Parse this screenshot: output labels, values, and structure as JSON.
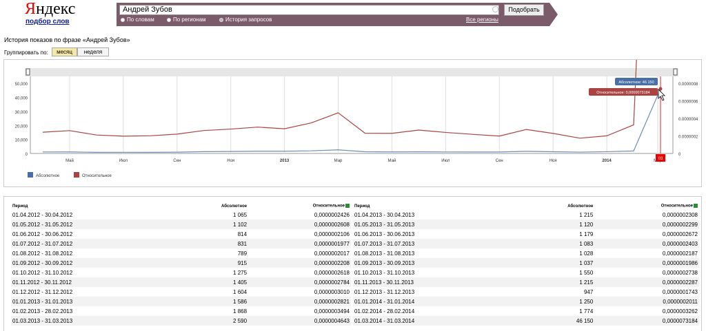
{
  "logo": {
    "brand": "Яндекс",
    "sublink": "подбор слов"
  },
  "search": {
    "value": "Андрей Зубов",
    "button_label": "Подобрать",
    "modes": [
      {
        "label": "По словам",
        "selected": false
      },
      {
        "label": "По регионам",
        "selected": false
      },
      {
        "label": "История запросов",
        "selected": true
      }
    ],
    "regions_link": "Все регионы"
  },
  "page": {
    "history_title": "История показов по фразе «Андрей Зубов»",
    "group_by_label": "Группировать по:",
    "group_options": [
      {
        "label": "месяц",
        "active": true
      },
      {
        "label": "неделя",
        "active": false
      }
    ]
  },
  "chart_data": {
    "type": "line",
    "x_ticks": [
      "Май",
      "Июл",
      "Сен",
      "Ноя",
      "2013",
      "Мар",
      "Май",
      "Июл",
      "Сен",
      "Ноя",
      "2014",
      "Мар"
    ],
    "x_tick_bold": [
      false,
      false,
      false,
      false,
      true,
      false,
      false,
      false,
      false,
      false,
      true,
      false
    ],
    "y_left_ticks": [
      "50,000",
      "40,000",
      "30,000",
      "20,000",
      "10,000",
      "0"
    ],
    "y_left_max": 55000,
    "y_right_ticks": [
      "0.0000008",
      "0.0000006",
      "0.0000004",
      "0.0000002",
      "0"
    ],
    "y_right_max": 8.8e-07,
    "series": [
      {
        "name": "Абсолютное",
        "color": "#4a6fa5",
        "values": [
          1065,
          1102,
          814,
          831,
          789,
          915,
          1275,
          1405,
          1604,
          1586,
          1868,
          2590,
          1215,
          1120,
          1179,
          1083,
          1028,
          1037,
          1550,
          1215,
          947,
          1250,
          1774,
          46150
        ]
      },
      {
        "name": "Относительное",
        "color": "#a94442",
        "values": [
          2.426e-07,
          2.608e-07,
          2.106e-07,
          1.977e-07,
          2.017e-07,
          2.208e-07,
          2.618e-07,
          2.784e-07,
          3.01e-07,
          2.821e-07,
          3.494e-07,
          4.643e-07,
          2.308e-07,
          2.299e-07,
          2.672e-07,
          2.403e-07,
          2.187e-07,
          1.986e-07,
          2.738e-07,
          2.287e-07,
          1.743e-07,
          2.011e-07,
          3.262e-07,
          7.3184e-06
        ]
      }
    ],
    "tooltip_abs": "Абсолютное: 46 150",
    "tooltip_rel": "Относительное: 0,0000073184",
    "marker_label": "03",
    "grid": true,
    "legend": "bottom-left"
  },
  "table": {
    "headers": {
      "period": "Период",
      "absolute": "Абсолютное",
      "relative": "Относительное"
    },
    "left_rows": [
      [
        "01.04.2012 - 30.04.2012",
        "1 065",
        "0,0000002426"
      ],
      [
        "01.05.2012 - 31.05.2012",
        "1 102",
        "0,0000002608"
      ],
      [
        "01.06.2012 - 30.06.2012",
        "814",
        "0,0000002106"
      ],
      [
        "01.07.2012 - 31.07.2012",
        "831",
        "0,0000001977"
      ],
      [
        "01.08.2012 - 31.08.2012",
        "789",
        "0,0000002017"
      ],
      [
        "01.09.2012 - 30.09.2012",
        "915",
        "0,0000002208"
      ],
      [
        "01.10.2012 - 31.10.2012",
        "1 275",
        "0,0000002618"
      ],
      [
        "01.11.2012 - 30.11.2012",
        "1 405",
        "0,0000002784"
      ],
      [
        "01.12.2012 - 31.12.2012",
        "1 604",
        "0,0000003010"
      ],
      [
        "01.01.2013 - 31.01.2013",
        "1 586",
        "0,0000002821"
      ],
      [
        "01.02.2013 - 28.02.2013",
        "1 868",
        "0,0000003494"
      ],
      [
        "01.03.2013 - 31.03.2013",
        "2 590",
        "0,0000004643"
      ]
    ],
    "right_rows": [
      [
        "01.04.2013 - 30.04.2013",
        "1 215",
        "0,0000002308"
      ],
      [
        "01.05.2013 - 31.05.2013",
        "1 120",
        "0,0000002299"
      ],
      [
        "01.06.2013 - 30.06.2013",
        "1 179",
        "0,0000002672"
      ],
      [
        "01.07.2013 - 31.07.2013",
        "1 083",
        "0,0000002403"
      ],
      [
        "01.08.2013 - 31.08.2013",
        "1 028",
        "0,0000002187"
      ],
      [
        "01.09.2013 - 30.09.2013",
        "1 037",
        "0,0000001986"
      ],
      [
        "01.10.2013 - 31.10.2013",
        "1 550",
        "0,0000002738"
      ],
      [
        "01.11.2013 - 30.11.2013",
        "1 215",
        "0,0000002287"
      ],
      [
        "01.12.2013 - 31.12.2013",
        "947",
        "0,0000001743"
      ],
      [
        "01.01.2014 - 31.01.2014",
        "1 250",
        "0,0000002011"
      ],
      [
        "01.02.2014 - 28.02.2014",
        "1 774",
        "0,0000003262"
      ],
      [
        "01.03.2014 - 31.03.2014",
        "46 150",
        "0,0000073184"
      ]
    ]
  }
}
